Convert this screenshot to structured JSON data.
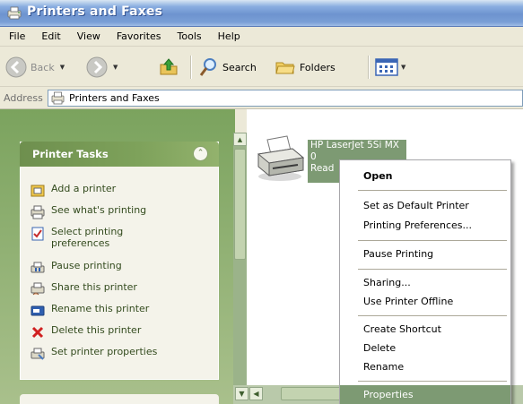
{
  "window": {
    "title": "Printers and Faxes"
  },
  "menubar": {
    "items": [
      "File",
      "Edit",
      "View",
      "Favorites",
      "Tools",
      "Help"
    ]
  },
  "toolbar": {
    "back_label": "Back",
    "search_label": "Search",
    "folders_label": "Folders"
  },
  "address": {
    "label": "Address",
    "value": "Printers and Faxes"
  },
  "tasks": {
    "title": "Printer Tasks",
    "items": [
      {
        "label": "Add a printer",
        "icon": "add-printer-icon"
      },
      {
        "label": "See what's printing",
        "icon": "print-queue-icon"
      },
      {
        "label": "Select printing preferences",
        "icon": "preferences-icon"
      },
      {
        "label": "Pause printing",
        "icon": "pause-printer-icon"
      },
      {
        "label": "Share this printer",
        "icon": "share-printer-icon"
      },
      {
        "label": "Rename this printer",
        "icon": "rename-icon"
      },
      {
        "label": "Delete this printer",
        "icon": "delete-icon"
      },
      {
        "label": "Set printer properties",
        "icon": "properties-icon"
      }
    ]
  },
  "printer": {
    "name": "HP LaserJet 5Si MX",
    "docs": "0",
    "status": "Read"
  },
  "context_menu": {
    "items": [
      {
        "label": "Open",
        "bold": true
      },
      {
        "label": "Set as Default Printer"
      },
      {
        "label": "Printing Preferences..."
      },
      {
        "label": "Pause Printing"
      },
      {
        "label": "Sharing..."
      },
      {
        "label": "Use Printer Offline"
      },
      {
        "label": "Create Shortcut"
      },
      {
        "label": "Delete"
      },
      {
        "label": "Rename"
      },
      {
        "label": "Properties",
        "selected": true
      }
    ]
  },
  "colors": {
    "accent": "#7d9a73",
    "title_bar": "#7a9fd6",
    "panel_green": "#7ea25b"
  }
}
